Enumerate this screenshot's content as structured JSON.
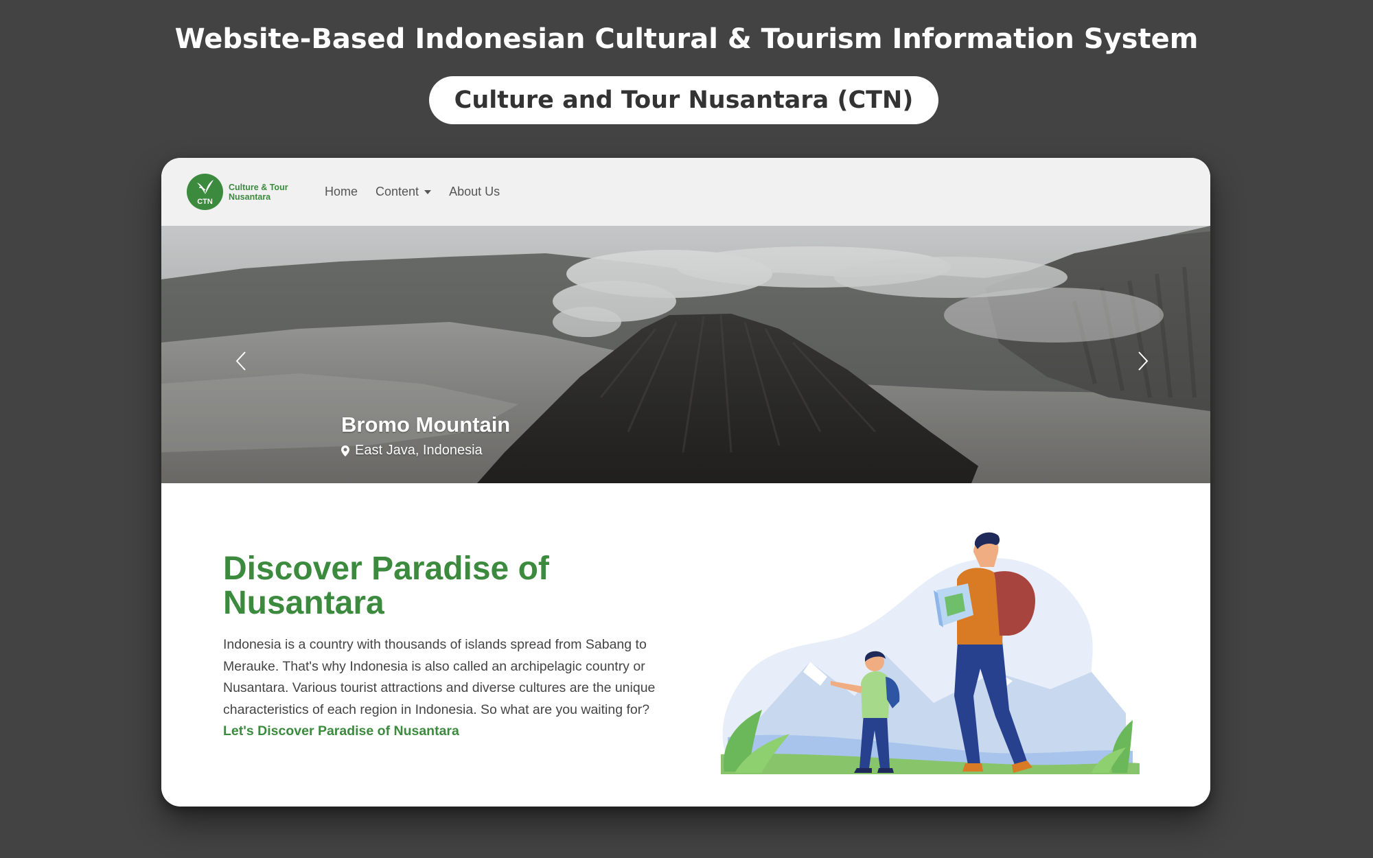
{
  "page": {
    "heading": "Website-Based Indonesian Cultural & Tourism Information System",
    "subheading": "Culture and Tour Nusantara (CTN)"
  },
  "navbar": {
    "logo_abbr": "CTN",
    "logo_line1": "Culture & Tour",
    "logo_line2": "Nusantara",
    "links": [
      {
        "label": "Home"
      },
      {
        "label": "Content"
      },
      {
        "label": "About Us"
      }
    ]
  },
  "hero": {
    "title": "Bromo Mountain",
    "location": "East Java, Indonesia",
    "prev_icon": "chevron-left-icon",
    "next_icon": "chevron-right-icon"
  },
  "intro": {
    "title": "Discover Paradise of Nusantara",
    "body": "Indonesia is a country with thousands of islands spread from Sabang to Merauke. That's why Indonesia is also called an archipelagic country or Nusantara. Various tourist attractions and diverse cultures are the unique characteristics of each region in Indonesia. So what are you waiting for?",
    "cta": "Let's Discover Paradise of Nusantara"
  },
  "colors": {
    "background": "#434343",
    "brand_green": "#3b8a3e",
    "navbar_bg": "#f1f1f1"
  }
}
